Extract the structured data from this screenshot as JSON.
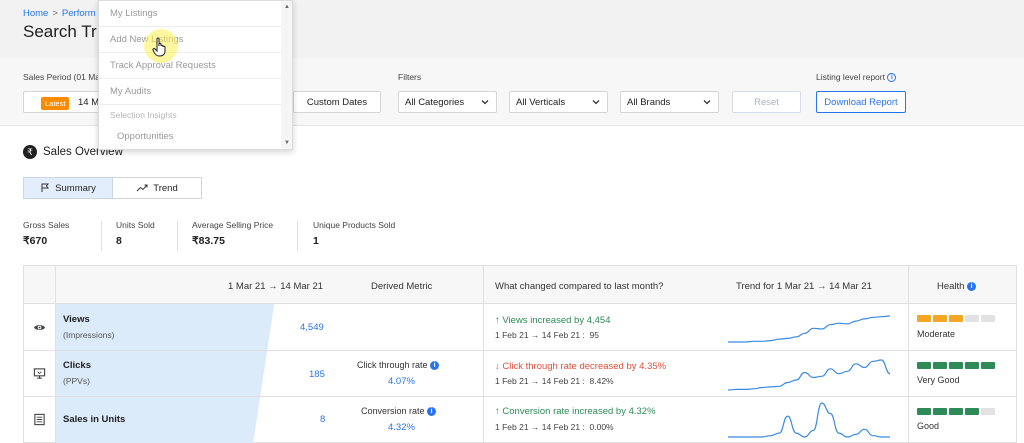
{
  "breadcrumb": {
    "home": "Home",
    "separator": ">",
    "current": "Perform"
  },
  "page": {
    "title": "Search Tr"
  },
  "filters": {
    "sales_period_label": "Sales Period (01 Ma",
    "latest_badge": "Latest",
    "period_value": "14 M",
    "custom_dates": "Custom Dates",
    "filters_label": "Filters",
    "categories": "All Categories",
    "verticals": "All Verticals",
    "brands": "All Brands",
    "reset": "Reset",
    "listing_report_label": "Listing level report",
    "download_report": "Download Report"
  },
  "dropdown": {
    "items": [
      "My Listings",
      "Add New Listings",
      "Track Approval Requests",
      "My Audits"
    ],
    "section_label": "Selection Insights",
    "sub_item": "Opportunities"
  },
  "overview": {
    "title": "Sales Overview",
    "tabs": [
      "Summary",
      "Trend"
    ],
    "active_tab": "Summary"
  },
  "stats": [
    {
      "label": "Gross Sales",
      "value": "₹670"
    },
    {
      "label": "Units Sold",
      "value": "8"
    },
    {
      "label": "Average Selling Price",
      "value": "₹83.75"
    },
    {
      "label": "Unique Products Sold",
      "value": "1"
    }
  ],
  "table": {
    "headers": {
      "period": "1 Mar 21 → 14 Mar 21",
      "derived": "Derived Metric",
      "changed": "What changed compared to last month?",
      "trend": "Trend for 1 Mar 21 → 14 Mar 21",
      "health": "Health"
    },
    "rows": [
      {
        "icon": "eye-icon",
        "name": "Views",
        "sub": "(Impressions)",
        "value": "4,549",
        "derived_label": "",
        "derived_value": "",
        "change": "↑ Views increased by 4,454",
        "change_dir": "up",
        "prev_range": "1 Feb 21 → 14 Feb 21 :",
        "prev_value": "95",
        "health_filled": 3,
        "health_color": "#f5a623",
        "health_label": "Moderate",
        "trend": [
          1.0,
          1.0,
          1.0,
          1.05,
          1.05,
          1.1,
          1.2,
          1.25,
          1.35,
          1.6,
          1.95,
          1.9,
          2.2,
          2.3,
          2.25,
          2.45,
          2.6,
          2.7,
          2.75,
          2.8
        ]
      },
      {
        "icon": "monitor-icon",
        "name": "Clicks",
        "sub": "(PPVs)",
        "value": "185",
        "derived_label": "Click through rate",
        "derived_value": "4.07%",
        "change": "↓ Click through rate decreased by 4.35%",
        "change_dir": "down",
        "prev_range": "1 Feb 21 → 14 Feb 21 :",
        "prev_value": "8.42%",
        "health_filled": 5,
        "health_color": "#2e8b57",
        "health_label": "Very Good",
        "trend": [
          0.2,
          0.25,
          0.25,
          0.3,
          0.4,
          0.45,
          0.5,
          0.8,
          1.0,
          1.6,
          1.2,
          1.3,
          1.9,
          1.5,
          1.7,
          2.3,
          2.0,
          2.5,
          2.6,
          1.5
        ]
      },
      {
        "icon": "list-icon",
        "name": "Sales in Units",
        "sub": "",
        "value": "8",
        "derived_label": "Conversion rate",
        "derived_value": "4.32%",
        "change": "↑ Conversion rate increased by 4.32%",
        "change_dir": "up",
        "prev_range": "1 Feb 21 → 14 Feb 21 :",
        "prev_value": "0.00%",
        "health_filled": 4,
        "health_color": "#2e8b57",
        "health_label": "Good",
        "trend": [
          0,
          0,
          0,
          0,
          0,
          0.1,
          0.3,
          1.6,
          0.3,
          0,
          0.5,
          2.6,
          1.8,
          0.3,
          0,
          0.2,
          0.6,
          0.1,
          0,
          0
        ]
      }
    ]
  }
}
